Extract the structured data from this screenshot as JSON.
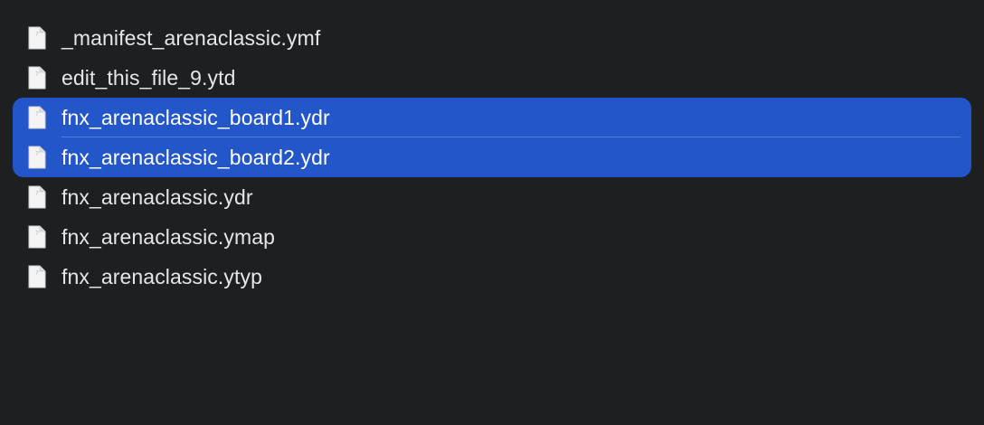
{
  "files": [
    {
      "name": "_manifest_arenaclassic.ymf",
      "selected": false
    },
    {
      "name": "edit_this_file_9.ytd",
      "selected": false
    },
    {
      "name": "fnx_arenaclassic_board1.ydr",
      "selected": true
    },
    {
      "name": "fnx_arenaclassic_board2.ydr",
      "selected": true
    },
    {
      "name": "fnx_arenaclassic.ydr",
      "selected": false
    },
    {
      "name": "fnx_arenaclassic.ymap",
      "selected": false
    },
    {
      "name": "fnx_arenaclassic.ytyp",
      "selected": false
    }
  ],
  "colors": {
    "background": "#1e1f21",
    "selection": "#2356c9",
    "text": "#e6e6e6"
  },
  "icons": {
    "file": "document-icon"
  }
}
